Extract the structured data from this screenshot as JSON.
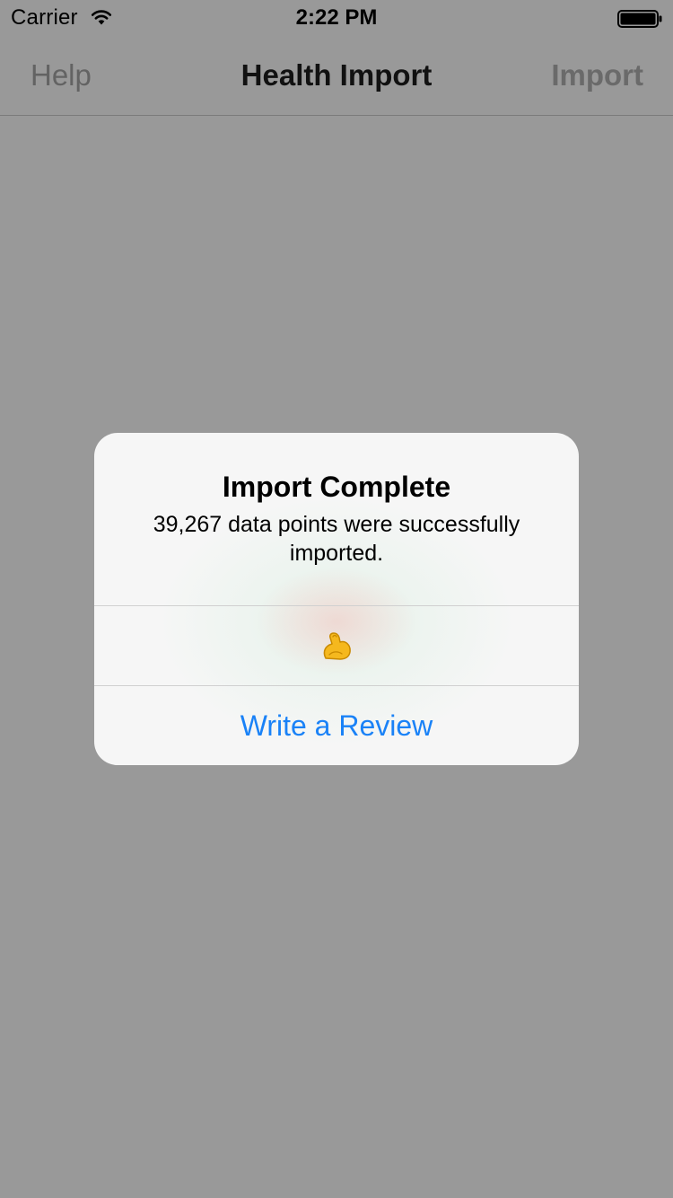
{
  "status_bar": {
    "carrier": "Carrier",
    "time": "2:22 PM",
    "wifi_icon": "wifi-icon",
    "battery_icon": "battery-icon"
  },
  "nav": {
    "left_label": "Help",
    "title": "Health Import",
    "right_label": "Import"
  },
  "alert": {
    "title": "Import Complete",
    "message": "39,267 data points were successfully imported.",
    "actions": [
      {
        "icon": "flexed-biceps-icon"
      },
      {
        "label": "Write a Review"
      }
    ]
  },
  "colors": {
    "background": "#999999",
    "alert_background": "#f6f6f6",
    "action_blue": "#1a82f7",
    "nav_disabled": "#636363"
  }
}
